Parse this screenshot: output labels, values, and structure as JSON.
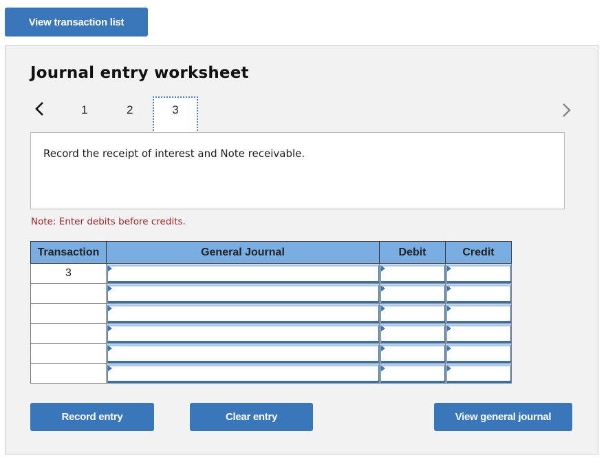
{
  "top_button": {
    "label": "View transaction list"
  },
  "worksheet": {
    "title": "Journal entry worksheet",
    "pagination": {
      "prev_icon": "chevron-left-icon",
      "next_icon": "chevron-right-icon",
      "pages": [
        "1",
        "2",
        "3"
      ],
      "active_page": "3"
    },
    "prompt": "Record the receipt of interest and Note receivable.",
    "note": "Note: Enter debits before credits.",
    "table": {
      "headers": [
        "Transaction",
        "General Journal",
        "Debit",
        "Credit"
      ],
      "rows": [
        {
          "transaction": "3",
          "general_journal": "",
          "debit": "",
          "credit": ""
        },
        {
          "transaction": "",
          "general_journal": "",
          "debit": "",
          "credit": ""
        },
        {
          "transaction": "",
          "general_journal": "",
          "debit": "",
          "credit": ""
        },
        {
          "transaction": "",
          "general_journal": "",
          "debit": "",
          "credit": ""
        },
        {
          "transaction": "",
          "general_journal": "",
          "debit": "",
          "credit": ""
        },
        {
          "transaction": "",
          "general_journal": "",
          "debit": "",
          "credit": ""
        }
      ]
    },
    "buttons": {
      "record": "Record entry",
      "clear": "Clear entry",
      "view_general_journal": "View general journal"
    }
  },
  "colors": {
    "button_blue": "#3a76ba",
    "header_blue": "#7aaee3",
    "note_red": "#a0212b",
    "panel_bg": "#f2f2f2"
  }
}
